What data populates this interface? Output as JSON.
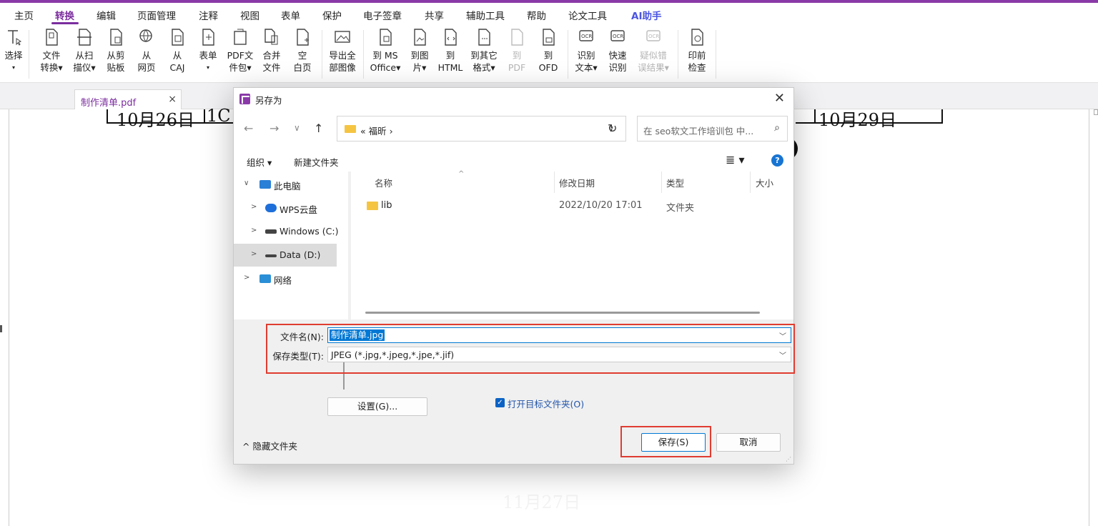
{
  "menubar": {
    "items": [
      "主页",
      "转换",
      "编辑",
      "页面管理",
      "注释",
      "视图",
      "表单",
      "保护",
      "电子签章",
      "共享",
      "辅助工具",
      "帮助",
      "论文工具",
      "AI助手"
    ],
    "active": "转换"
  },
  "ribbon": {
    "buttons": [
      {
        "line1": "选择",
        "line2": "▾",
        "icon": "select-text-icon"
      },
      {
        "line1": "文件",
        "line2": "转换▾",
        "icon": "file-convert-icon"
      },
      {
        "line1": "从扫",
        "line2": "描仪▾",
        "icon": "scanner-icon"
      },
      {
        "line1": "从剪",
        "line2": "贴板",
        "icon": "clipboard-icon"
      },
      {
        "line1": "从",
        "line2": "网页",
        "icon": "web-globe-icon"
      },
      {
        "line1": "从",
        "line2": "CAJ",
        "icon": "caj-file-icon"
      },
      {
        "line1": "表单",
        "line2": "▾",
        "icon": "form-icon"
      },
      {
        "line1": "PDF文",
        "line2": "件包▾",
        "icon": "pdf-package-icon"
      },
      {
        "line1": "合并",
        "line2": "文件",
        "icon": "merge-files-icon"
      },
      {
        "line1": "空",
        "line2": "白页",
        "icon": "blank-page-icon"
      },
      {
        "line1": "导出全",
        "line2": "部图像",
        "icon": "export-images-icon"
      },
      {
        "line1": "到 MS",
        "line2": "Office▾",
        "icon": "to-office-icon"
      },
      {
        "line1": "到图",
        "line2": "片▾",
        "icon": "to-image-icon"
      },
      {
        "line1": "到",
        "line2": "HTML",
        "icon": "to-html-icon"
      },
      {
        "line1": "到其它",
        "line2": "格式▾",
        "icon": "to-other-format-icon"
      },
      {
        "line1": "到",
        "line2": "PDF",
        "icon": "to-pdf-icon",
        "disabled": true
      },
      {
        "line1": "到",
        "line2": "OFD",
        "icon": "to-ofd-icon"
      },
      {
        "line1": "识别",
        "line2": "文本▾",
        "icon": "ocr-text-icon"
      },
      {
        "line1": "快速",
        "line2": "识别",
        "icon": "ocr-quick-icon"
      },
      {
        "line1": "疑似错",
        "line2": "误结果▾",
        "icon": "ocr-suspect-icon",
        "disabled": true
      },
      {
        "line1": "印前",
        "line2": "检查",
        "icon": "preflight-icon"
      }
    ]
  },
  "tab": {
    "title": "制作清单.pdf",
    "close": "×"
  },
  "document": {
    "text_left": "10月26日",
    "text_left2": "1C",
    "text_right": "10月29日",
    "ghost": "11月27日"
  },
  "dialog": {
    "title": "另存为",
    "close": "✕",
    "nav": {
      "back": "←",
      "forward": "→",
      "recent": "∨",
      "up": "↑"
    },
    "address": {
      "prefix": "«",
      "folder": "福昕",
      "sep": "›",
      "dropdown": "∨"
    },
    "refresh": "↻",
    "search_placeholder": "在 seo软文工作培训包 中...",
    "search_icon": "⌕",
    "toolbar": {
      "organize": "组织 ▾",
      "new_folder": "新建文件夹",
      "view": "≣ ▾",
      "help": "?"
    },
    "tree": [
      {
        "label": "此电脑",
        "arrow": "∨",
        "icon": "pc-icon",
        "color": "#2a7fd6"
      },
      {
        "label": "WPS云盘",
        "arrow": ">",
        "icon": "cloud-icon",
        "color": "#1e6fd9"
      },
      {
        "label": "Windows (C:)",
        "arrow": ">",
        "icon": "drive-c-icon",
        "color": "#444444"
      },
      {
        "label": "Data (D:)",
        "arrow": ">",
        "icon": "drive-d-icon",
        "color": "#444444",
        "selected": true
      },
      {
        "label": "网络",
        "arrow": ">",
        "icon": "network-icon",
        "color": "#2a8fd6"
      }
    ],
    "columns": {
      "name": "名称",
      "date": "修改日期",
      "type": "类型",
      "size": "大小"
    },
    "files": [
      {
        "name": "lib",
        "date": "2022/10/20 17:01",
        "type": "文件夹"
      }
    ],
    "filename_label": "文件名(N):",
    "filename_value": "制作清单.jpg",
    "filetype_label": "保存类型(T):",
    "filetype_value": "JPEG (*.jpg,*.jpeg,*.jpe,*.jif)",
    "settings_button": "设置(G)...",
    "open_folder_label": "打开目标文件夹(O)",
    "open_folder_checked": true,
    "hide_folders": "^ 隐藏文件夹",
    "save_button": "保存(S)",
    "cancel_button": "取消"
  },
  "colors": {
    "accent": "#7b2d9e",
    "highlight": "#e03c31",
    "selection": "#0078d4"
  }
}
